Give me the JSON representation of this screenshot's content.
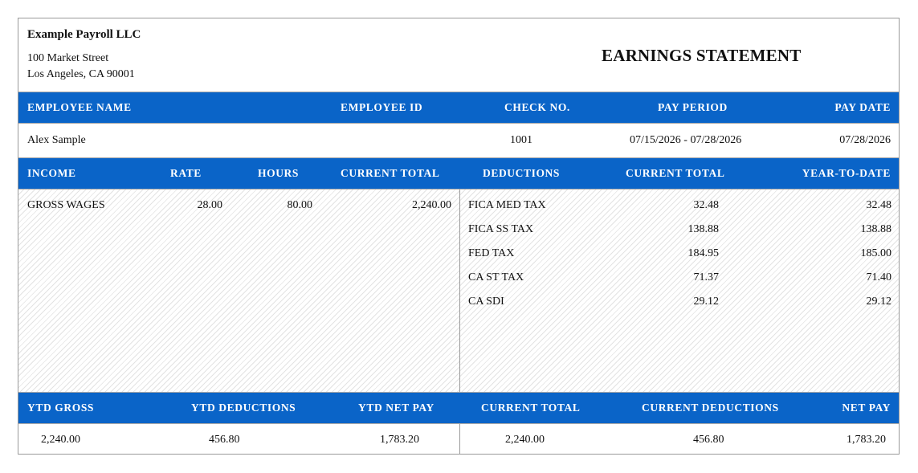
{
  "company": {
    "name": "Example Payroll LLC",
    "address_line1": "100 Market Street",
    "address_line2": "Los Angeles, CA 90001"
  },
  "title": "EARNINGS STATEMENT",
  "employee_header": {
    "employee_name": "EMPLOYEE NAME",
    "employee_id": "EMPLOYEE ID",
    "check_no": "CHECK NO.",
    "pay_period": "PAY PERIOD",
    "pay_date": "PAY DATE"
  },
  "employee": {
    "name": "Alex Sample",
    "id": "",
    "check_no": "1001",
    "pay_period": "07/15/2026 - 07/28/2026",
    "pay_date": "07/28/2026"
  },
  "detail_header": {
    "income": "INCOME",
    "rate": "RATE",
    "hours": "HOURS",
    "current_total": "CURRENT TOTAL",
    "deductions": "DEDUCTIONS",
    "ded_current_total": "CURRENT TOTAL",
    "ytd": "YEAR-TO-DATE"
  },
  "income": [
    {
      "label": "GROSS WAGES",
      "rate": "28.00",
      "hours": "80.00",
      "current": "2,240.00"
    }
  ],
  "deductions": [
    {
      "label": "FICA MED TAX",
      "current": "32.48",
      "ytd": "32.48"
    },
    {
      "label": "FICA SS TAX",
      "current": "138.88",
      "ytd": "138.88"
    },
    {
      "label": "FED TAX",
      "current": "184.95",
      "ytd": "185.00"
    },
    {
      "label": "CA ST TAX",
      "current": "71.37",
      "ytd": "71.40"
    },
    {
      "label": "CA SDI",
      "current": "29.12",
      "ytd": "29.12"
    }
  ],
  "summary_header": {
    "ytd_gross": "YTD GROSS",
    "ytd_deductions": "YTD DEDUCTIONS",
    "ytd_net_pay": "YTD NET PAY",
    "current_total": "CURRENT TOTAL",
    "current_deductions": "CURRENT DEDUCTIONS",
    "net_pay": "NET PAY"
  },
  "summary": {
    "ytd_gross": "2,240.00",
    "ytd_deductions": "456.80",
    "ytd_net_pay": "1,783.20",
    "current_total": "2,240.00",
    "current_deductions": "456.80",
    "net_pay": "1,783.20"
  },
  "colors": {
    "header_band": "#0a64c8",
    "border": "#9a9a9a"
  }
}
